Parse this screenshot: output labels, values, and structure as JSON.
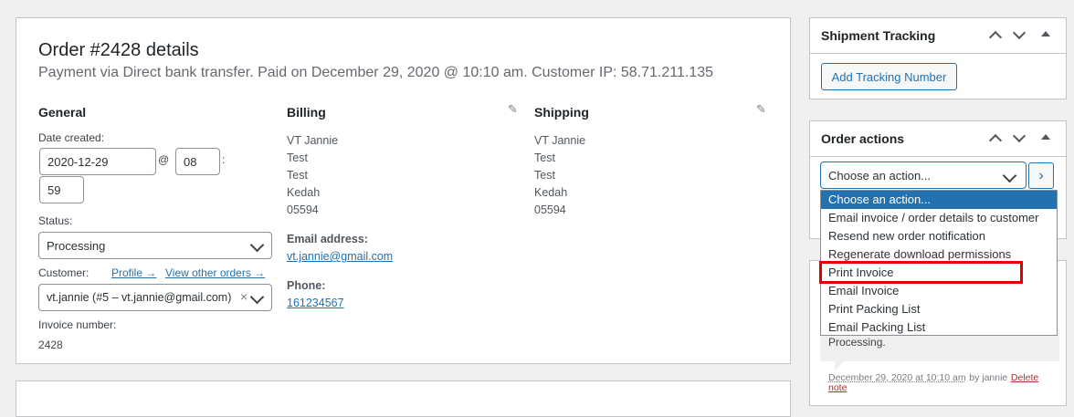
{
  "order": {
    "title": "Order #2428 details",
    "subtitle": "Payment via Direct bank transfer. Paid on December 29, 2020 @ 10:10 am. Customer IP: 58.71.211.135"
  },
  "general": {
    "heading": "General",
    "date_label": "Date created:",
    "date_value": "2020-12-29",
    "at_symbol": "@",
    "hour_value": "08",
    "colon": ":",
    "minute_value": "59",
    "status_label": "Status:",
    "status_value": "Processing",
    "customer_label": "Customer:",
    "profile_link": "Profile →",
    "other_orders_link": "View other orders →",
    "customer_value": "vt.jannie (#5 – vt.jannie@gmail.com)",
    "clear_symbol": "×",
    "invoice_label": "Invoice number:",
    "invoice_value": "2428"
  },
  "billing": {
    "heading": "Billing",
    "address": [
      "VT Jannie",
      "Test",
      "Test",
      "Kedah",
      "05594"
    ],
    "email_label": "Email address:",
    "email_value": "vt.jannie@gmail.com",
    "phone_label": "Phone:",
    "phone_value": "161234567"
  },
  "shipping": {
    "heading": "Shipping",
    "address": [
      "VT Jannie",
      "Test",
      "Test",
      "Kedah",
      "05594"
    ]
  },
  "icons": {
    "pencil": "✎",
    "arrow_next": "›"
  },
  "shipment_tracking": {
    "title": "Shipment Tracking",
    "button": "Add Tracking Number"
  },
  "order_actions": {
    "title": "Order actions",
    "select_value": "Choose an action...",
    "options": [
      "Choose an action...",
      "Email invoice / order details to customer",
      "Resend new order notification",
      "Regenerate download permissions",
      "Print Invoice",
      "Email Invoice",
      "Print Packing List",
      "Email Packing List"
    ]
  },
  "notes": {
    "text": "Processing.",
    "date": "December 29, 2020 at 10:10 am",
    "by": "by jannie",
    "delete_1": "Delete",
    "delete_2": "note"
  },
  "colors": {
    "accent": "#2271b1",
    "highlight": "#e00000",
    "background": "#f0f0f1"
  }
}
